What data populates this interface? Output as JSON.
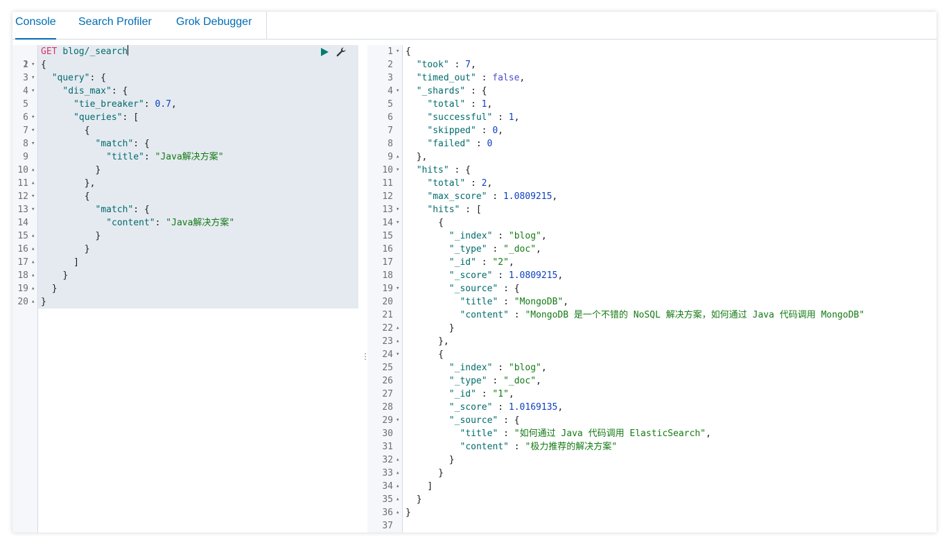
{
  "tabs": [
    {
      "label": "Console",
      "active": true
    },
    {
      "label": "Search Profiler",
      "active": false
    },
    {
      "label": "Grok Debugger",
      "active": false
    }
  ],
  "request": {
    "method": "GET",
    "path": "blog/_search",
    "lines": [
      {
        "n": "1",
        "fold": "",
        "indent": 0,
        "html": ""
      },
      {
        "n": "2",
        "fold": "▾",
        "indent": 0,
        "html": "{"
      },
      {
        "n": "3",
        "fold": "▾",
        "indent": 2,
        "html": "<span class=\"k\">\"query\"</span>: {"
      },
      {
        "n": "4",
        "fold": "▾",
        "indent": 4,
        "html": "<span class=\"k\">\"dis_max\"</span>: {"
      },
      {
        "n": "5",
        "fold": "",
        "indent": 6,
        "html": "<span class=\"k\">\"tie_breaker\"</span>: <span class=\"n\">0.7</span>,"
      },
      {
        "n": "6",
        "fold": "▾",
        "indent": 6,
        "html": "<span class=\"k\">\"queries\"</span>: ["
      },
      {
        "n": "7",
        "fold": "▾",
        "indent": 8,
        "html": "{"
      },
      {
        "n": "8",
        "fold": "▾",
        "indent": 10,
        "html": "<span class=\"k\">\"match\"</span>: {"
      },
      {
        "n": "9",
        "fold": "",
        "indent": 12,
        "html": "<span class=\"k\">\"title\"</span>: <span class=\"s\">\"Java解决方案\"</span>"
      },
      {
        "n": "10",
        "fold": "▴",
        "indent": 10,
        "html": "}"
      },
      {
        "n": "11",
        "fold": "▴",
        "indent": 8,
        "html": "},"
      },
      {
        "n": "12",
        "fold": "▾",
        "indent": 8,
        "html": "{"
      },
      {
        "n": "13",
        "fold": "▾",
        "indent": 10,
        "html": "<span class=\"k\">\"match\"</span>: {"
      },
      {
        "n": "14",
        "fold": "",
        "indent": 12,
        "html": "<span class=\"k\">\"content\"</span>: <span class=\"s\">\"Java解决方案\"</span>"
      },
      {
        "n": "15",
        "fold": "▴",
        "indent": 10,
        "html": "}"
      },
      {
        "n": "16",
        "fold": "▴",
        "indent": 8,
        "html": "}"
      },
      {
        "n": "17",
        "fold": "▴",
        "indent": 6,
        "html": "]"
      },
      {
        "n": "18",
        "fold": "▴",
        "indent": 4,
        "html": "}"
      },
      {
        "n": "19",
        "fold": "▴",
        "indent": 2,
        "html": "}"
      },
      {
        "n": "20",
        "fold": "▴",
        "indent": 0,
        "html": "}"
      }
    ]
  },
  "response": {
    "lines": [
      {
        "n": "1",
        "fold": "▾",
        "indent": 0,
        "html": "{"
      },
      {
        "n": "2",
        "fold": "",
        "indent": 2,
        "html": "<span class=\"k\">\"took\"</span> : <span class=\"n\">7</span>,"
      },
      {
        "n": "3",
        "fold": "",
        "indent": 2,
        "html": "<span class=\"k\">\"timed_out\"</span> : <span class=\"b\">false</span>,"
      },
      {
        "n": "4",
        "fold": "▾",
        "indent": 2,
        "html": "<span class=\"k\">\"_shards\"</span> : {"
      },
      {
        "n": "5",
        "fold": "",
        "indent": 4,
        "html": "<span class=\"k\">\"total\"</span> : <span class=\"n\">1</span>,"
      },
      {
        "n": "6",
        "fold": "",
        "indent": 4,
        "html": "<span class=\"k\">\"successful\"</span> : <span class=\"n\">1</span>,"
      },
      {
        "n": "7",
        "fold": "",
        "indent": 4,
        "html": "<span class=\"k\">\"skipped\"</span> : <span class=\"n\">0</span>,"
      },
      {
        "n": "8",
        "fold": "",
        "indent": 4,
        "html": "<span class=\"k\">\"failed\"</span> : <span class=\"n\">0</span>"
      },
      {
        "n": "9",
        "fold": "▴",
        "indent": 2,
        "html": "},"
      },
      {
        "n": "10",
        "fold": "▾",
        "indent": 2,
        "html": "<span class=\"k\">\"hits\"</span> : {"
      },
      {
        "n": "11",
        "fold": "",
        "indent": 4,
        "html": "<span class=\"k\">\"total\"</span> : <span class=\"n\">2</span>,"
      },
      {
        "n": "12",
        "fold": "",
        "indent": 4,
        "html": "<span class=\"k\">\"max_score\"</span> : <span class=\"n\">1.0809215</span>,"
      },
      {
        "n": "13",
        "fold": "▾",
        "indent": 4,
        "html": "<span class=\"k\">\"hits\"</span> : ["
      },
      {
        "n": "14",
        "fold": "▾",
        "indent": 6,
        "html": "{"
      },
      {
        "n": "15",
        "fold": "",
        "indent": 8,
        "html": "<span class=\"k\">\"_index\"</span> : <span class=\"s\">\"blog\"</span>,"
      },
      {
        "n": "16",
        "fold": "",
        "indent": 8,
        "html": "<span class=\"k\">\"_type\"</span> : <span class=\"s\">\"_doc\"</span>,"
      },
      {
        "n": "17",
        "fold": "",
        "indent": 8,
        "html": "<span class=\"k\">\"_id\"</span> : <span class=\"s\">\"2\"</span>,"
      },
      {
        "n": "18",
        "fold": "",
        "indent": 8,
        "html": "<span class=\"k\">\"_score\"</span> : <span class=\"n\">1.0809215</span>,"
      },
      {
        "n": "19",
        "fold": "▾",
        "indent": 8,
        "html": "<span class=\"k\">\"_source\"</span> : {"
      },
      {
        "n": "20",
        "fold": "",
        "indent": 10,
        "html": "<span class=\"k\">\"title\"</span> : <span class=\"s\">\"MongoDB\"</span>,"
      },
      {
        "n": "21",
        "fold": "",
        "indent": 10,
        "html": "<span class=\"k\">\"content\"</span> : <span class=\"s\">\"MongoDB 是一个不错的 NoSQL 解决方案，如何通过 Java 代码调用 MongoDB\"</span>"
      },
      {
        "n": "22",
        "fold": "▴",
        "indent": 8,
        "html": "}"
      },
      {
        "n": "23",
        "fold": "▴",
        "indent": 6,
        "html": "},"
      },
      {
        "n": "24",
        "fold": "▾",
        "indent": 6,
        "html": "{"
      },
      {
        "n": "25",
        "fold": "",
        "indent": 8,
        "html": "<span class=\"k\">\"_index\"</span> : <span class=\"s\">\"blog\"</span>,"
      },
      {
        "n": "26",
        "fold": "",
        "indent": 8,
        "html": "<span class=\"k\">\"_type\"</span> : <span class=\"s\">\"_doc\"</span>,"
      },
      {
        "n": "27",
        "fold": "",
        "indent": 8,
        "html": "<span class=\"k\">\"_id\"</span> : <span class=\"s\">\"1\"</span>,"
      },
      {
        "n": "28",
        "fold": "",
        "indent": 8,
        "html": "<span class=\"k\">\"_score\"</span> : <span class=\"n\">1.0169135</span>,"
      },
      {
        "n": "29",
        "fold": "▾",
        "indent": 8,
        "html": "<span class=\"k\">\"_source\"</span> : {"
      },
      {
        "n": "30",
        "fold": "",
        "indent": 10,
        "html": "<span class=\"k\">\"title\"</span> : <span class=\"s\">\"如何通过 Java 代码调用 ElasticSearch\"</span>,"
      },
      {
        "n": "31",
        "fold": "",
        "indent": 10,
        "html": "<span class=\"k\">\"content\"</span> : <span class=\"s\">\"极力推荐的解决方案\"</span>"
      },
      {
        "n": "32",
        "fold": "▴",
        "indent": 8,
        "html": "}"
      },
      {
        "n": "33",
        "fold": "▴",
        "indent": 6,
        "html": "}"
      },
      {
        "n": "34",
        "fold": "▴",
        "indent": 4,
        "html": "]"
      },
      {
        "n": "35",
        "fold": "▴",
        "indent": 2,
        "html": "}"
      },
      {
        "n": "36",
        "fold": "▴",
        "indent": 0,
        "html": "}"
      },
      {
        "n": "37",
        "fold": "",
        "indent": 0,
        "html": ""
      }
    ]
  },
  "icons": {
    "run": "play-icon",
    "settings": "wrench-icon",
    "divider": "⋮"
  },
  "colors": {
    "accent": "#006bb4",
    "keyword": "#006b6b",
    "string": "#137a13",
    "number": "#0b3fbf",
    "method": "#d6336c"
  }
}
